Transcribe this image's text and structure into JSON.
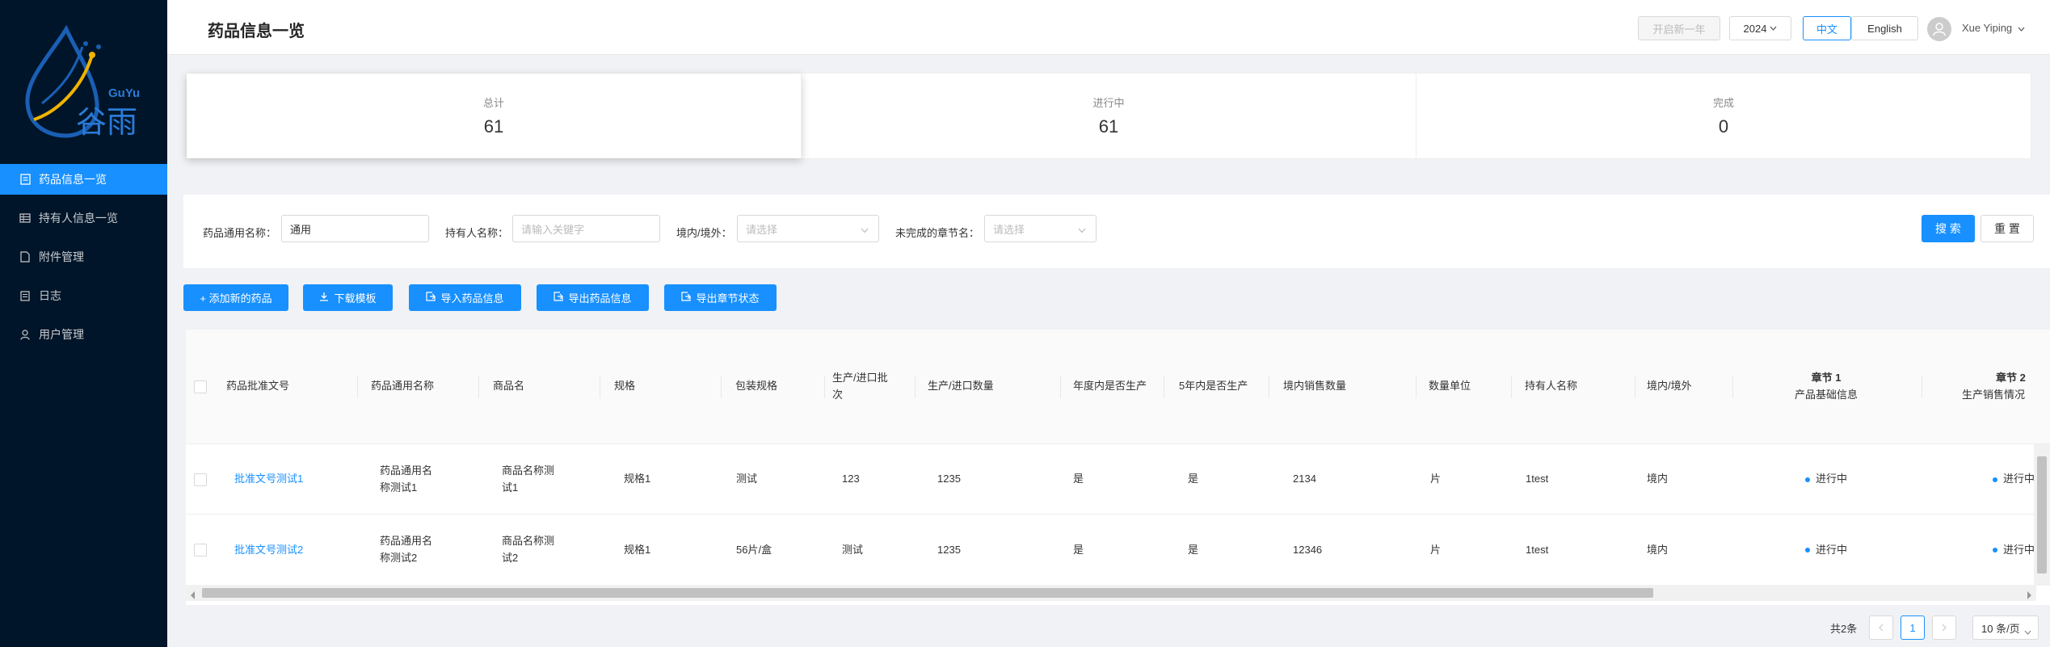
{
  "brand": {
    "name_latin": "GuYu",
    "name_cn": "谷雨"
  },
  "sidebar": {
    "items": [
      {
        "label": "药品信息一览",
        "icon": "document-icon",
        "active": true
      },
      {
        "label": "持有人信息一览",
        "icon": "table-icon",
        "active": false
      },
      {
        "label": "附件管理",
        "icon": "file-icon",
        "active": false
      },
      {
        "label": "日志",
        "icon": "log-icon",
        "active": false
      },
      {
        "label": "用户管理",
        "icon": "user-icon",
        "active": false
      }
    ]
  },
  "header": {
    "title": "药品信息一览",
    "new_year_label": "开启新一年",
    "year": "2024",
    "lang_cn": "中文",
    "lang_en": "English",
    "user_name": "Xue Yiping"
  },
  "stats": [
    {
      "label": "总计",
      "value": "61"
    },
    {
      "label": "进行中",
      "value": "61"
    },
    {
      "label": "完成",
      "value": "0"
    }
  ],
  "filter": {
    "generic_name_label": "药品通用名称：",
    "generic_name_value": "通用",
    "holder_label": "持有人名称：",
    "holder_placeholder": "请输入关键字",
    "domestic_label": "境内/境外：",
    "domestic_placeholder": "请选择",
    "chapter_label": "未完成的章节名：",
    "chapter_placeholder": "请选择",
    "search_label": "搜 索",
    "reset_label": "重 置"
  },
  "actions": {
    "add": "+ 添加新的药品",
    "download": "下载模板",
    "import": "导入药品信息",
    "export": "导出药品信息",
    "export_chapter": "导出章节状态"
  },
  "table": {
    "headers": {
      "approval_no": "药品批准文号",
      "generic_name": "药品通用名称",
      "trade_name": "商品名",
      "spec": "规格",
      "package": "包装规格",
      "batch_1": "生产/进口批",
      "batch_2": "次",
      "quantity": "生产/进口数量",
      "year_produced": "年度内是否生产",
      "five_year_produced": "5年内是否生产",
      "domestic_sales": "境内销售数量",
      "unit": "数量单位",
      "holder": "持有人名称",
      "domestic": "境内/境外",
      "chapter1_title": "章节 1",
      "chapter1_sub": "产品基础信息",
      "chapter2_title": "章节 2",
      "chapter2_sub": "生产销售情况"
    },
    "rows": [
      {
        "approval_no": "批准文号测试1",
        "generic_name_1": "药品通用名",
        "generic_name_2": "称测试1",
        "trade_name_1": "商品名称测",
        "trade_name_2": "试1",
        "spec": "规格1",
        "package": "测试",
        "batch": "123",
        "quantity": "1235",
        "year_produced": "是",
        "five_year_produced": "是",
        "domestic_sales": "2134",
        "unit": "片",
        "holder": "1test",
        "domestic": "境内",
        "chapter1": "进行中",
        "chapter2": "进行中"
      },
      {
        "approval_no": "批准文号测试2",
        "generic_name_1": "药品通用名",
        "generic_name_2": "称测试2",
        "trade_name_1": "商品名称测",
        "trade_name_2": "试2",
        "spec": "规格1",
        "package": "56片/盒",
        "batch": "测试",
        "quantity": "1235",
        "year_produced": "是",
        "five_year_produced": "是",
        "domestic_sales": "12346",
        "unit": "片",
        "holder": "1test",
        "domestic": "境内",
        "chapter1": "进行中",
        "chapter2": "进行中"
      }
    ]
  },
  "pagination": {
    "total": "共2条",
    "current_page": "1",
    "page_size": "10 条/页"
  }
}
